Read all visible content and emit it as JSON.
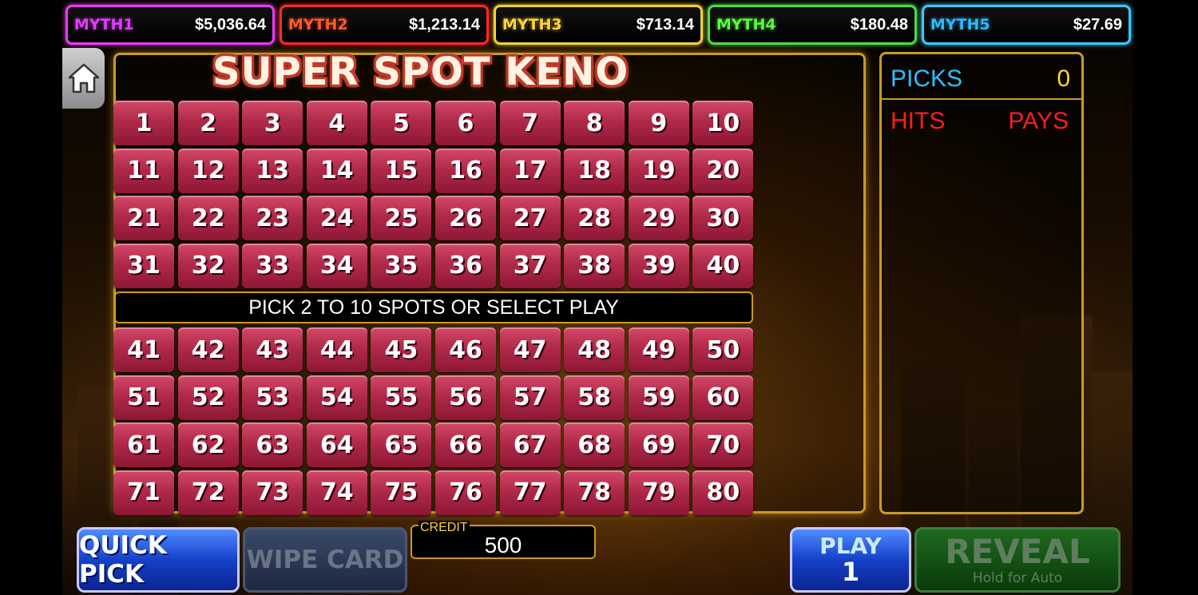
{
  "jackpots": [
    {
      "name": "MYTH1",
      "amount": "$5,036.64",
      "color": "#e23cff",
      "border": "#e63cf0"
    },
    {
      "name": "MYTH2",
      "amount": "$1,213.14",
      "color": "#ff5a2a",
      "border": "#ff2a2a"
    },
    {
      "name": "MYTH3",
      "amount": "$713.14",
      "color": "#ffd43a",
      "border": "#f2d23a"
    },
    {
      "name": "MYTH4",
      "amount": "$180.48",
      "color": "#58ff3a",
      "border": "#4fd84a"
    },
    {
      "name": "MYTH5",
      "amount": "$27.69",
      "color": "#2fb8ff",
      "border": "#3ac8ff"
    }
  ],
  "home_icon": "home-icon",
  "title": "SUPER SPOT KENO",
  "numbers_top": [
    "1",
    "2",
    "3",
    "4",
    "5",
    "6",
    "7",
    "8",
    "9",
    "10",
    "11",
    "12",
    "13",
    "14",
    "15",
    "16",
    "17",
    "18",
    "19",
    "20",
    "21",
    "22",
    "23",
    "24",
    "25",
    "26",
    "27",
    "28",
    "29",
    "30",
    "31",
    "32",
    "33",
    "34",
    "35",
    "36",
    "37",
    "38",
    "39",
    "40"
  ],
  "numbers_bottom": [
    "41",
    "42",
    "43",
    "44",
    "45",
    "46",
    "47",
    "48",
    "49",
    "50",
    "51",
    "52",
    "53",
    "54",
    "55",
    "56",
    "57",
    "58",
    "59",
    "60",
    "61",
    "62",
    "63",
    "64",
    "65",
    "66",
    "67",
    "68",
    "69",
    "70",
    "71",
    "72",
    "73",
    "74",
    "75",
    "76",
    "77",
    "78",
    "79",
    "80"
  ],
  "message": "PICK 2 TO 10 SPOTS OR SELECT PLAY",
  "panel": {
    "picks_label": "PICKS",
    "picks_value": "0",
    "hits_label": "HITS",
    "pays_label": "PAYS"
  },
  "buttons": {
    "quick_pick": "QUICK PICK",
    "wipe_card": "WIPE CARD",
    "play_label": "PLAY",
    "play_value": "1",
    "reveal_label": "REVEAL",
    "reveal_sub": "Hold for Auto"
  },
  "credit": {
    "label": "CREDIT",
    "value": "500"
  }
}
